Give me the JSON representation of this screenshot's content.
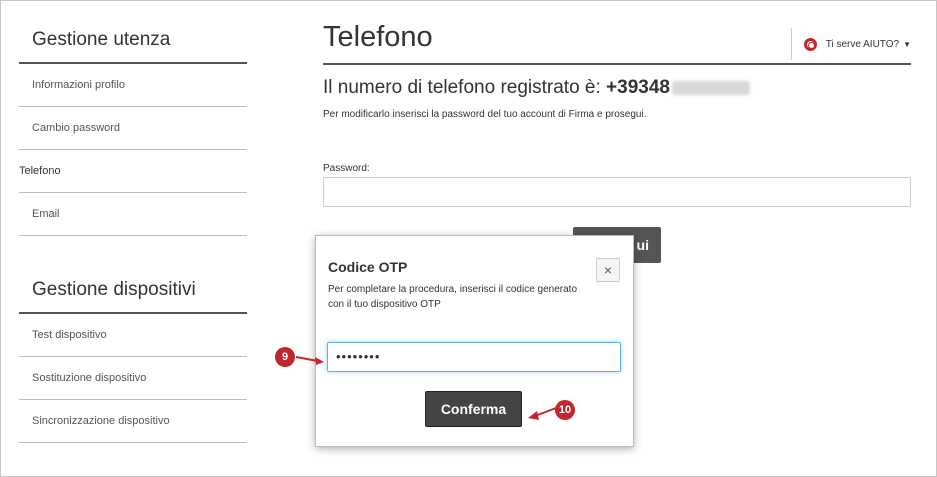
{
  "sidebar": {
    "section1_title": "Gestione utenza",
    "section1_items": [
      "Informazioni profilo",
      "Cambio password",
      "Telefono",
      "Email"
    ],
    "section2_title": "Gestione dispositivi",
    "section2_items": [
      "Test dispositivo",
      "Sostituzione dispositivo",
      "Sincronizzazione dispositivo"
    ],
    "active_item": "Telefono"
  },
  "main": {
    "title": "Telefono",
    "help_label": "Ti serve AIUTO?",
    "phone_prefix": "Il numero di telefono registrato è: ",
    "phone_number_visible": "+39348",
    "hint": "Per modificarlo inserisci la password del tuo account di Firma e prosegui.",
    "password_label": "Password:",
    "background_button_partial": "ui"
  },
  "modal": {
    "title": "Codice OTP",
    "text": "Per completare la procedura, inserisci il codice generato con il tuo dispositivo OTP",
    "close_label": "×",
    "otp_value": "••••••••",
    "confirm_label": "Conferma"
  },
  "callouts": {
    "step_a": "9",
    "step_b": "10"
  },
  "colors": {
    "accent_red": "#c0282e",
    "button_dark": "#444444",
    "focus_blue": "#66afe9"
  }
}
